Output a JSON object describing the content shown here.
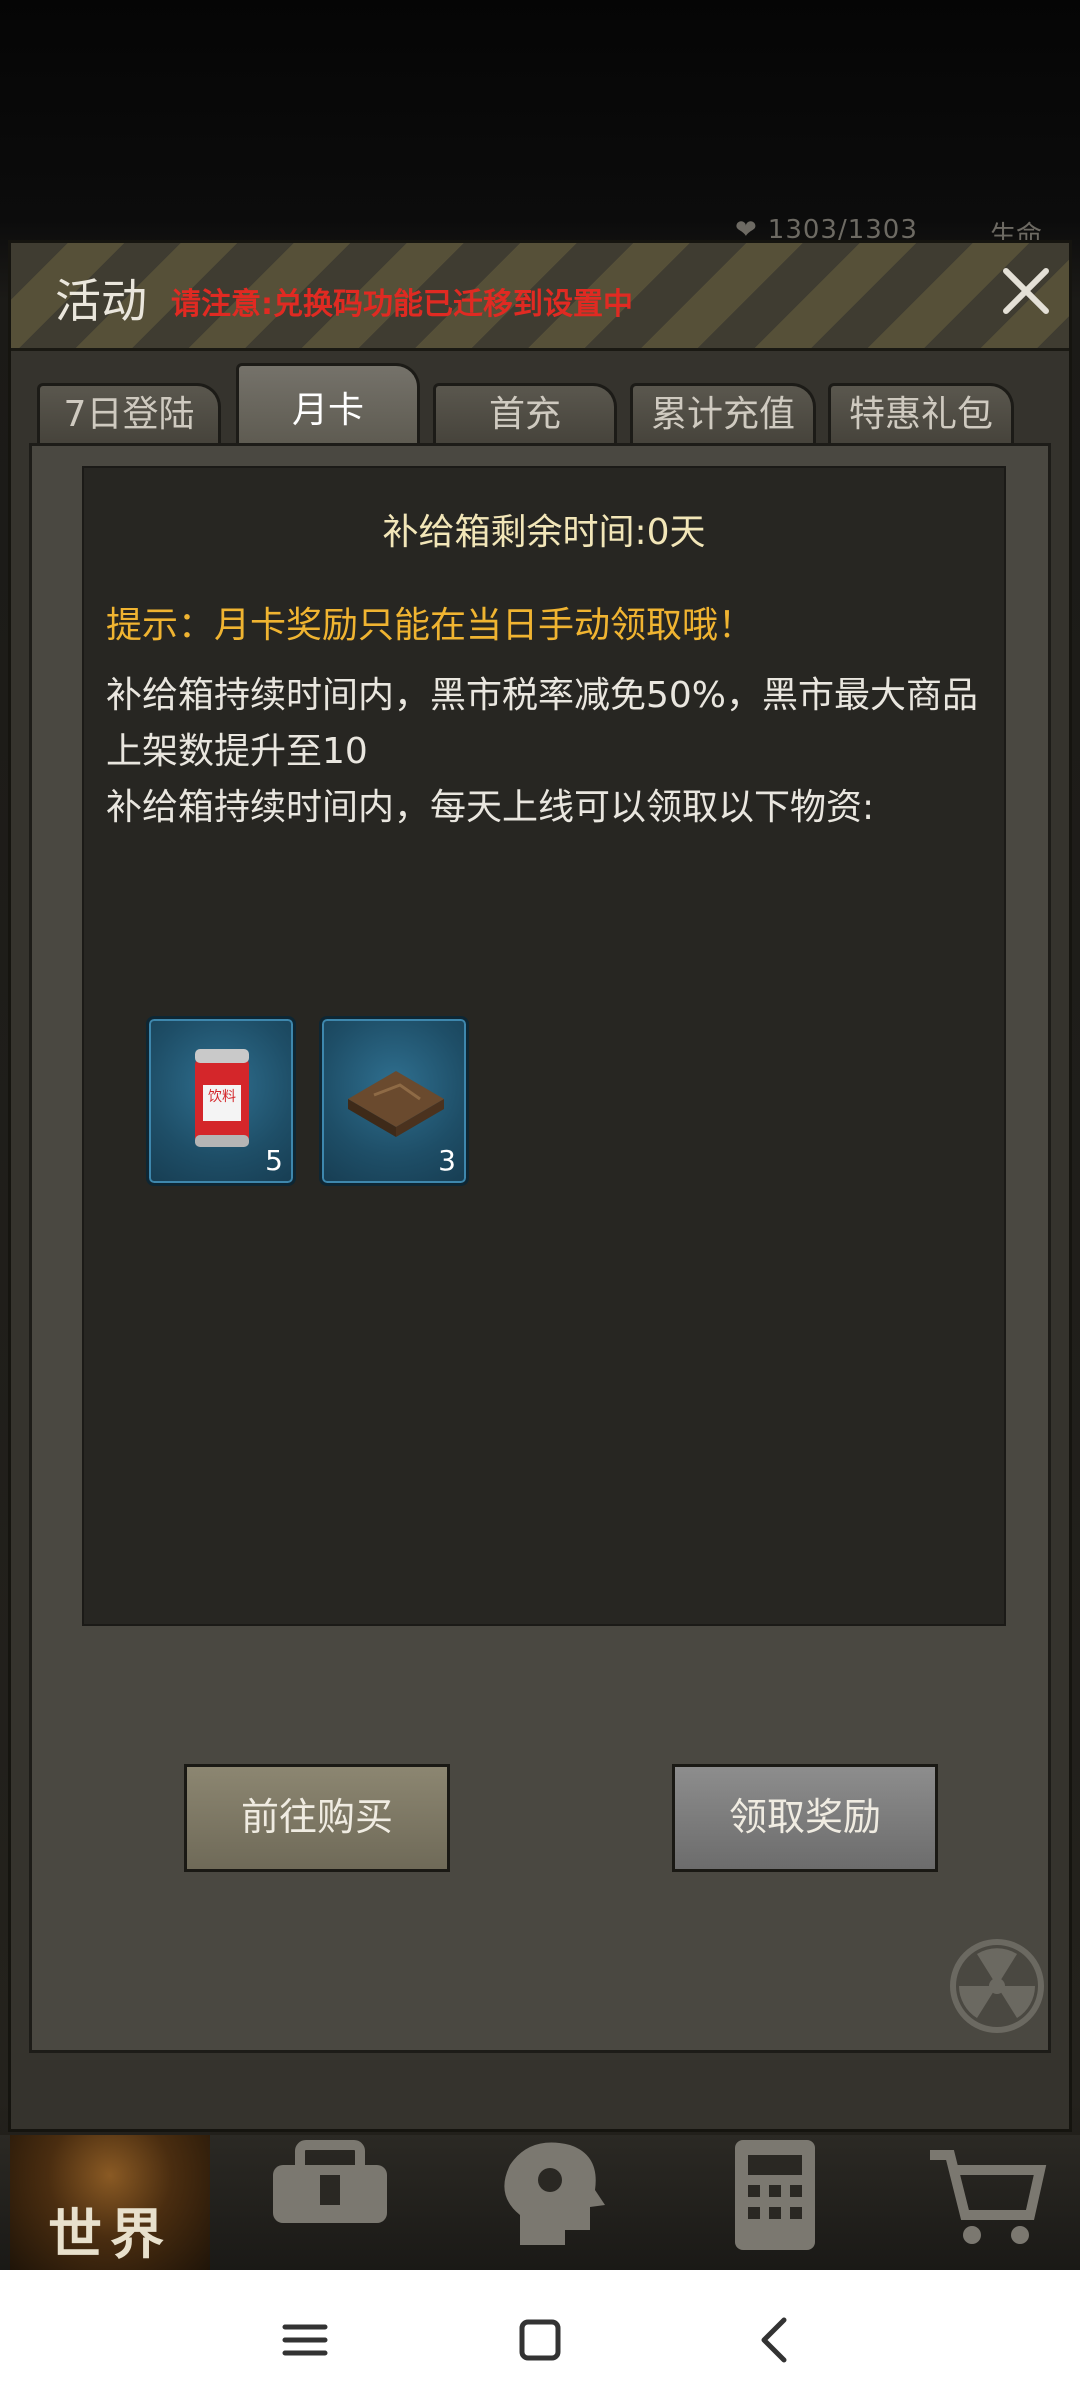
{
  "status": {
    "hp_text": "1303/1303",
    "life_label": "生命"
  },
  "dialog": {
    "title": "活动",
    "notice": "请注意:兑换码功能已迁移到设置中"
  },
  "tabs": [
    {
      "label": "7日登陆",
      "active": false
    },
    {
      "label": "月卡",
      "active": true
    },
    {
      "label": "首充",
      "active": false
    },
    {
      "label": "累计充值",
      "active": false
    },
    {
      "label": "特惠礼包",
      "active": false
    }
  ],
  "monthly_card": {
    "remaining": "补给箱剩余时间:0天",
    "tip": "提示：月卡奖励只能在当日手动领取哦！",
    "desc1": "补给箱持续时间内，黑市税率减免50%，黑市最大商品上架数提升至10",
    "desc2": "补给箱持续时间内，每天上线可以领取以下物资:",
    "rewards": [
      {
        "name": "drink-can",
        "label": "饮料",
        "count": "5"
      },
      {
        "name": "box-item",
        "count": "3"
      }
    ],
    "buy_label": "前往购买",
    "claim_label": "领取奖励"
  },
  "game_nav": {
    "world_label": "世界"
  },
  "colors": {
    "notice_red": "#e02a22",
    "tip_orange": "#f0b431",
    "slot_blue": "#1e4e67"
  }
}
